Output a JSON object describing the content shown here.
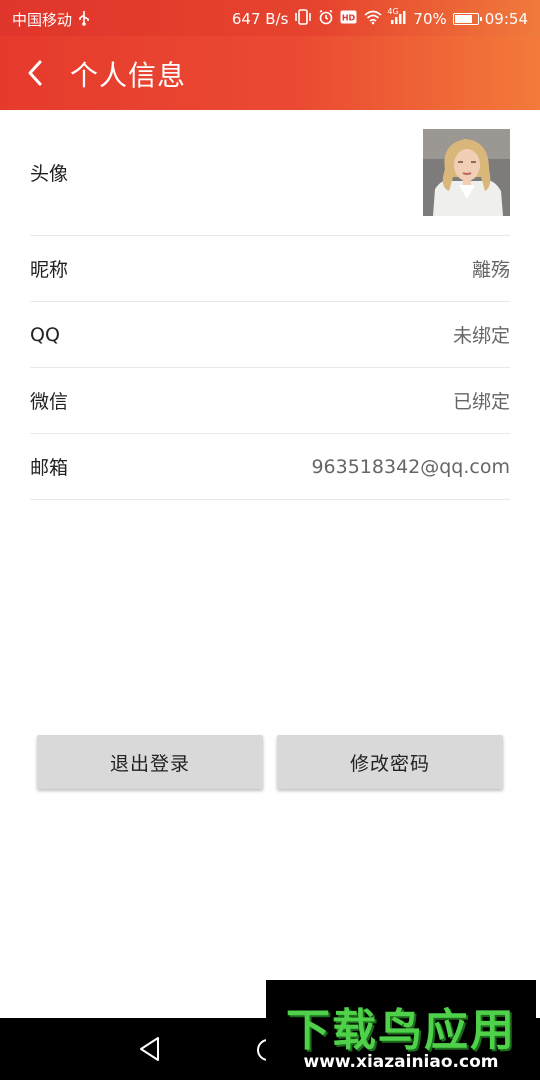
{
  "status_bar": {
    "carrier": "中国移动",
    "usb_icon": "usb-icon",
    "speed": "647 B/s",
    "icons": [
      "vibrate-icon",
      "alarm-icon",
      "hd-icon",
      "wifi-icon",
      "4g-signal-icon"
    ],
    "network_label": "4G",
    "battery_percent": "70%",
    "battery_level": 0.7,
    "time": "09:54"
  },
  "header": {
    "back_icon": "back-arrow-icon",
    "title": "个人信息",
    "background_colors": [
      "#e63a2d",
      "#f37a3a"
    ]
  },
  "profile": {
    "avatar_label": "头像",
    "rows": [
      {
        "label": "昵称",
        "value": "離殇"
      },
      {
        "label": "QQ",
        "value": "未绑定"
      },
      {
        "label": "微信",
        "value": "已绑定"
      },
      {
        "label": "邮箱",
        "value": "963518342@qq.com"
      }
    ]
  },
  "actions": {
    "logout_label": "退出登录",
    "change_password_label": "修改密码"
  },
  "nav_bar": {
    "icons": [
      "nav-back-icon",
      "nav-home-icon"
    ]
  },
  "watermark": {
    "logo_text": "下载鸟应用",
    "url": "www.xiazainiao.com"
  }
}
